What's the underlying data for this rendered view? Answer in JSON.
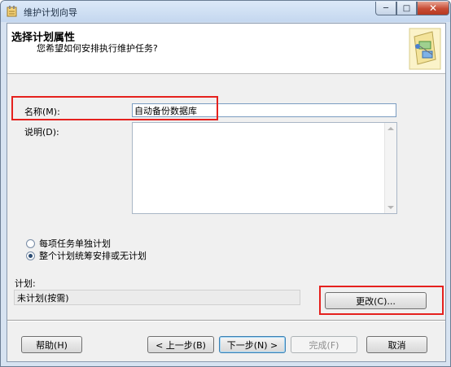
{
  "window": {
    "title": "维护计划向导",
    "min_glyph": "─",
    "max_glyph": "□",
    "close_glyph": "✕"
  },
  "header": {
    "title": "选择计划属性",
    "subtitle": "您希望如何安排执行维护任务?"
  },
  "form": {
    "name_label": "名称(M):",
    "name_value": "自动备份数据库",
    "description_label": "说明(D):",
    "description_value": ""
  },
  "options": {
    "radio_separate": "每项任务单独计划",
    "radio_single": "整个计划统筹安排或无计划",
    "selected": "single"
  },
  "schedule": {
    "label": "计划:",
    "value": "未计划(按需)",
    "change_button": "更改(C)..."
  },
  "footer": {
    "help": "帮助(H)",
    "back": "< 上一步(B)",
    "next": "下一步(N) >",
    "finish": "完成(F)",
    "cancel": "取消"
  },
  "colors": {
    "highlight_box": "#e5211e",
    "title_bar": "#c4d7ef"
  },
  "icons": {
    "app": "wizard-app-icon",
    "header": "maintenance-plan-icon"
  }
}
